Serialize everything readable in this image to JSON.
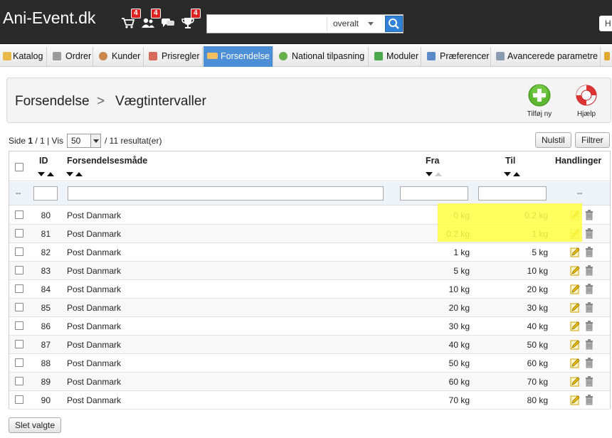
{
  "header": {
    "brand": "Ani-Event.dk",
    "notifications": [
      {
        "icon": "cart-icon",
        "count": "4"
      },
      {
        "icon": "customers-icon",
        "count": "4"
      },
      {
        "icon": "messages-icon",
        "count": "4"
      },
      {
        "icon": "trophy-icon",
        "count": "4"
      }
    ],
    "search": {
      "value": "",
      "placeholder": "",
      "scope": "overalt"
    },
    "corner_button": "H"
  },
  "nav": {
    "tabs": [
      {
        "label": "Katalog",
        "icon": "folder-icon"
      },
      {
        "label": "Ordrer",
        "icon": "cart-icon"
      },
      {
        "label": "Kunder",
        "icon": "customers-icon"
      },
      {
        "label": "Prisregler",
        "icon": "price-rules-icon"
      },
      {
        "label": "Forsendelse",
        "icon": "truck-icon",
        "active": true
      },
      {
        "label": "National tilpasning",
        "icon": "globe-icon"
      },
      {
        "label": "Moduler",
        "icon": "puzzle-icon"
      },
      {
        "label": "Præferencer",
        "icon": "preferences-icon"
      },
      {
        "label": "Avancerede parametre",
        "icon": "wrench-icon"
      }
    ]
  },
  "page": {
    "breadcrumb_parent": "Forsendelse",
    "breadcrumb_sep": ">",
    "breadcrumb_current": "Vægtintervaller",
    "add_new_label": "Tilføj ny",
    "help_label": "Hjælp"
  },
  "list": {
    "pager_prefix": "Side",
    "page_current": "1",
    "page_total": "/ 1",
    "show_label": "| Vis",
    "per_page": "50",
    "result_text": "/ 11 resultat(er)",
    "reset_button": "Nulstil",
    "filter_button": "Filtrer",
    "bulk_delete_button": "Slet valgte"
  },
  "table": {
    "columns": {
      "id": "ID",
      "carrier": "Forsendelsesmåde",
      "from": "Fra",
      "to": "Til",
      "actions": "Handlinger"
    },
    "filter_dash": "--",
    "rows": [
      {
        "id": "80",
        "carrier": "Post Danmark",
        "from": "0 kg",
        "to": "0.2 kg"
      },
      {
        "id": "81",
        "carrier": "Post Danmark",
        "from": "0.2 kg",
        "to": "1 kg"
      },
      {
        "id": "82",
        "carrier": "Post Danmark",
        "from": "1 kg",
        "to": "5 kg"
      },
      {
        "id": "83",
        "carrier": "Post Danmark",
        "from": "5 kg",
        "to": "10 kg"
      },
      {
        "id": "84",
        "carrier": "Post Danmark",
        "from": "10 kg",
        "to": "20 kg"
      },
      {
        "id": "85",
        "carrier": "Post Danmark",
        "from": "20 kg",
        "to": "30 kg"
      },
      {
        "id": "86",
        "carrier": "Post Danmark",
        "from": "30 kg",
        "to": "40 kg"
      },
      {
        "id": "87",
        "carrier": "Post Danmark",
        "from": "40 kg",
        "to": "50 kg"
      },
      {
        "id": "88",
        "carrier": "Post Danmark",
        "from": "50 kg",
        "to": "60 kg"
      },
      {
        "id": "89",
        "carrier": "Post Danmark",
        "from": "60 kg",
        "to": "70 kg"
      },
      {
        "id": "90",
        "carrier": "Post Danmark",
        "from": "70 kg",
        "to": "80 kg"
      }
    ]
  },
  "colors": {
    "header_bg": "#2a2a2a",
    "active_tab": "#4c8fd6",
    "highlight": "#ffff44",
    "badge": "#dd2222"
  }
}
